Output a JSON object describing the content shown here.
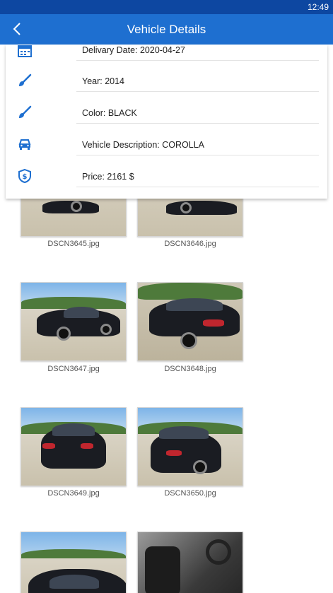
{
  "status": {
    "time": "12:49"
  },
  "header": {
    "title": "Vehicle Details"
  },
  "details": {
    "delivery_date": "Delivary Date: 2020-04-27",
    "year": "Year: 2014",
    "color": "Color: BLACK",
    "description": "Vehicle Description: COROLLA",
    "price": "Price: 2161 $"
  },
  "photos": [
    {
      "caption": "DSCN3645.jpg"
    },
    {
      "caption": "DSCN3646.jpg"
    },
    {
      "caption": "DSCN3647.jpg"
    },
    {
      "caption": "DSCN3648.jpg"
    },
    {
      "caption": "DSCN3649.jpg"
    },
    {
      "caption": "DSCN3650.jpg"
    }
  ],
  "colors": {
    "appbar": "#1e6fd0",
    "statusbar": "#0d47a1",
    "icon": "#1e6fd0"
  }
}
